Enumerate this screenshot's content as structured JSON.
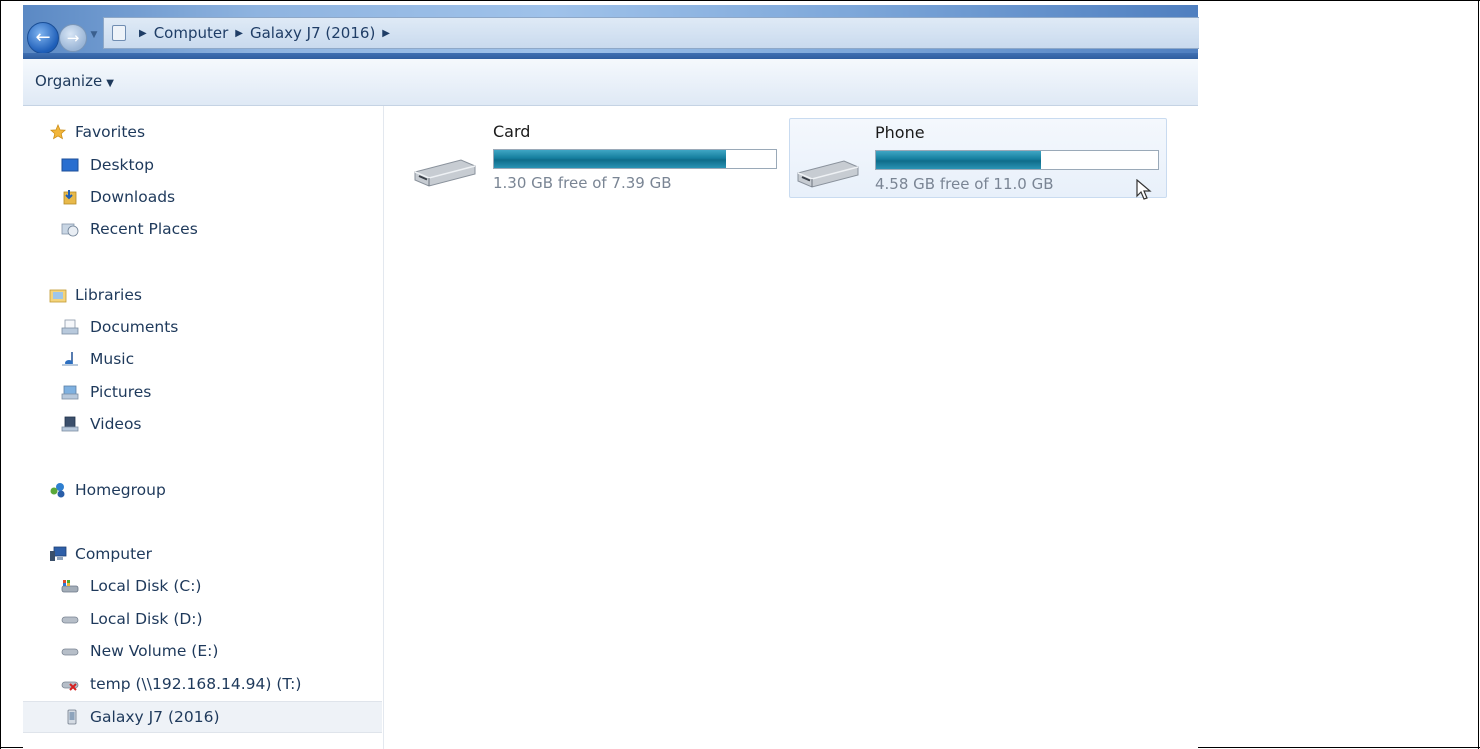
{
  "window": {
    "breadcrumb": [
      "Computer",
      "Galaxy J7 (2016)"
    ],
    "organize_label": "Organize"
  },
  "sidebar": {
    "items": [
      {
        "label": "Favorites",
        "icon": "star-icon"
      },
      {
        "label": "Desktop",
        "icon": "desktop-icon"
      },
      {
        "label": "Downloads",
        "icon": "downloads-icon"
      },
      {
        "label": "Recent Places",
        "icon": "recent-places-icon"
      },
      {
        "label": "Libraries",
        "icon": "libraries-icon"
      },
      {
        "label": "Documents",
        "icon": "documents-icon"
      },
      {
        "label": "Music",
        "icon": "music-icon"
      },
      {
        "label": "Pictures",
        "icon": "pictures-icon"
      },
      {
        "label": "Videos",
        "icon": "videos-icon"
      },
      {
        "label": "Homegroup",
        "icon": "homegroup-icon"
      },
      {
        "label": "Computer",
        "icon": "computer-icon"
      },
      {
        "label": "Local Disk (C:)",
        "icon": "system-drive-icon"
      },
      {
        "label": "Local Disk (D:)",
        "icon": "drive-icon"
      },
      {
        "label": "New Volume (E:)",
        "icon": "drive-icon"
      },
      {
        "label": "temp (\\\\192.168.14.94) (T:)",
        "icon": "disconnected-network-drive-icon"
      },
      {
        "label": "Galaxy J7 (2016)",
        "icon": "phone-device-icon",
        "selected": true
      }
    ]
  },
  "drives": [
    {
      "name": "Card",
      "free_text": "1.30 GB free of 7.39 GB",
      "used_fraction": 0.824
    },
    {
      "name": "Phone",
      "free_text": "4.58 GB free of 11.0 GB",
      "used_fraction": 0.584
    }
  ],
  "colors": {
    "bar_fill": "#157e9e",
    "accent": "#1e395b"
  }
}
